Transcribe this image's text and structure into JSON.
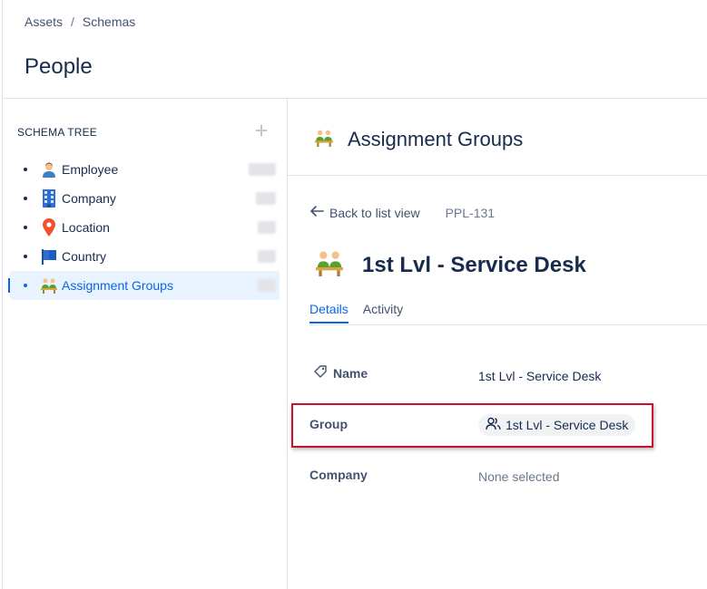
{
  "breadcrumb": [
    "Assets",
    "Schemas"
  ],
  "breadcrumb_separator": "/",
  "page_title": "People",
  "sidebar": {
    "header": "SCHEMA TREE",
    "add_icon": "plus-icon",
    "items": [
      {
        "label": "Employee",
        "icon": "person-icon"
      },
      {
        "label": "Company",
        "icon": "building-icon"
      },
      {
        "label": "Location",
        "icon": "location-pin-icon"
      },
      {
        "label": "Country",
        "icon": "flag-icon"
      },
      {
        "label": "Assignment Groups",
        "icon": "people-group-icon",
        "active": true
      }
    ]
  },
  "main": {
    "object_type_title": "Assignment Groups",
    "back_label": "Back to list view",
    "object_key": "PPL-131",
    "object_title": "1st Lvl - Service Desk",
    "tabs": [
      {
        "label": "Details",
        "active": true
      },
      {
        "label": "Activity",
        "active": false
      }
    ],
    "attributes": {
      "name_label": "Name",
      "name_value": "1st Lvl - Service Desk",
      "group_label": "Group",
      "group_value": "1st Lvl - Service Desk",
      "company_label": "Company",
      "company_value": "None selected"
    }
  },
  "colors": {
    "accent": "#0c66e4",
    "highlight": "#c8102e",
    "text": "#172b4d"
  }
}
